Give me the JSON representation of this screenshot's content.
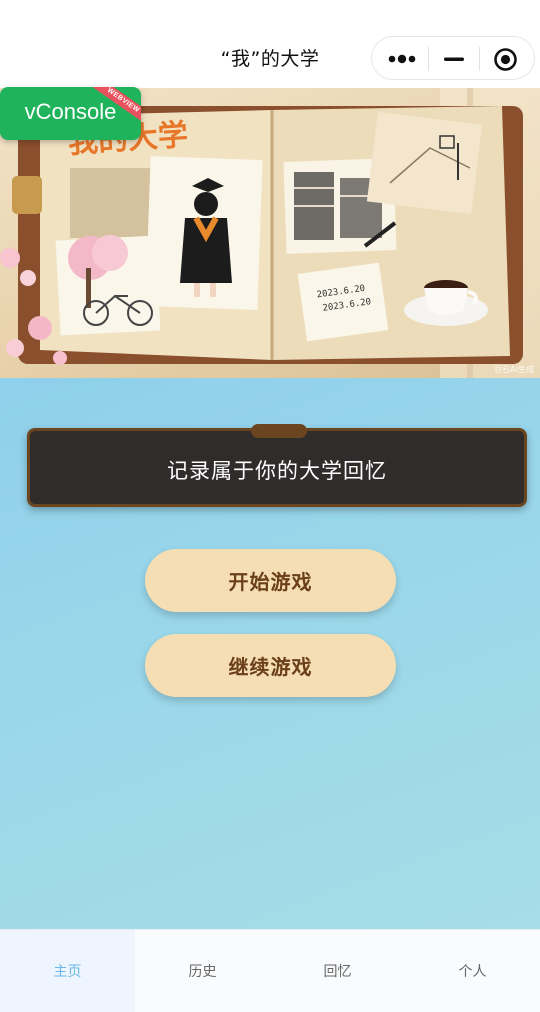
{
  "navbar": {
    "title": "“我”的大学",
    "capsule": {
      "more_icon": "more-dots-icon",
      "minimize_icon": "minimize-icon",
      "close_icon": "target-close-icon"
    }
  },
  "banner": {
    "heading_art": "我的大学",
    "date_note": [
      "2023.6.20",
      "2023.6.20"
    ],
    "credit": "豆包AI生成"
  },
  "vconsole": {
    "label": "vConsole",
    "ribbon": "WEBVIEW"
  },
  "board": {
    "text": "记录属于你的大学回忆"
  },
  "buttons": {
    "start": "开始游戏",
    "continue": "继续游戏"
  },
  "tabbar": {
    "items": [
      {
        "label": "主页",
        "active": true
      },
      {
        "label": "历史",
        "active": false
      },
      {
        "label": "回忆",
        "active": false
      },
      {
        "label": "个人",
        "active": false
      }
    ]
  },
  "colors": {
    "main_bg": "#9ad7ea",
    "board_bg": "#2f2c2b",
    "board_border": "#6b4420",
    "button_bg": "#f5deb3",
    "button_text": "#6b3f1b",
    "tab_active": "#6bb8e8",
    "vconsole": "#1fb45c"
  }
}
